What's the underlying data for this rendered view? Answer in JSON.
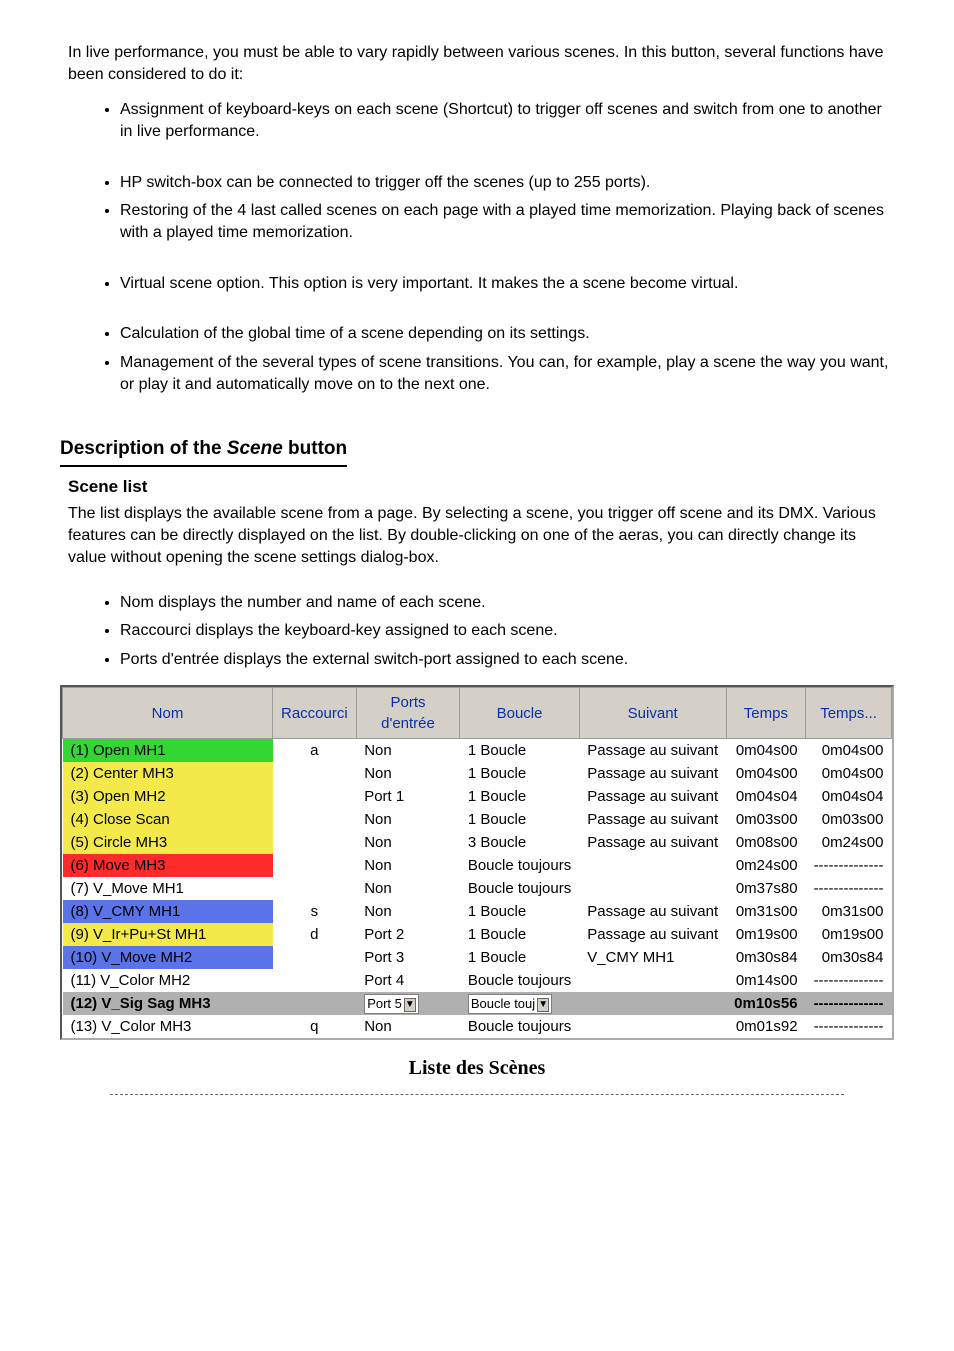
{
  "text": {
    "p1": "In live performance, you must be able to vary rapidly between various scenes. In this button, several functions have been considered to do it:",
    "bullets1": [
      "Assignment of keyboard-keys on each scene (Shortcut) to trigger off scenes and switch from one to another in live performance.",
      "HP switch-box can be connected to trigger off the scenes (up to 255 ports).",
      "Restoring of the 4 last called scenes on each page with a played time memorization. Playing back of scenes with a played time memorization."
    ],
    "bullets2": [
      "Virtual scene option. This option is very important. It makes the a scene become virtual.",
      "Calculation of the global time of a scene depending on its settings.",
      "Management of the several types of scene transitions. You can, for example, play a scene the way you want, or play it and automatically move on to the next one."
    ],
    "sectionTitlePrefix": "Description of the ",
    "sectionTitleItalic": "Scene",
    "sectionTitleSuffix": " button",
    "subtitle": "Scene list",
    "intro": "The list displays the available scene from a page. By selecting a scene, you trigger off scene and its DMX. Various features can be directly displayed on the list. By double-clicking on one of the aeras, you can directly change its value without opening the scene settings dialog-box.",
    "bullets3": [
      "Nom displays the number and name of each scene.",
      "Raccourci displays the keyboard-key assigned to each scene.",
      "Ports d'entrée displays the external switch-port assigned to each scene."
    ],
    "caption": "Liste des Scènes"
  },
  "table": {
    "headers": [
      "Nom",
      "Raccourci",
      "Ports d'entrée",
      "Boucle",
      "Suivant",
      "Temps",
      "Temps..."
    ],
    "rows": [
      {
        "color": "#33d633",
        "name": "(1) Open MH1",
        "sc": "a",
        "port": "Non",
        "boucle": "1 Boucle",
        "suivant": "Passage au suivant",
        "t1": "0m04s00",
        "t2": "0m04s00"
      },
      {
        "color": "#f3e94a",
        "name": "(2) Center MH3",
        "sc": "",
        "port": "Non",
        "boucle": "1 Boucle",
        "suivant": "Passage au suivant",
        "t1": "0m04s00",
        "t2": "0m04s00"
      },
      {
        "color": "#f3e94a",
        "name": "(3) Open MH2",
        "sc": "",
        "port": "Port 1",
        "boucle": "1 Boucle",
        "suivant": "Passage au suivant",
        "t1": "0m04s04",
        "t2": "0m04s04"
      },
      {
        "color": "#f3e94a",
        "name": "(4) Close Scan",
        "sc": "",
        "port": "Non",
        "boucle": "1 Boucle",
        "suivant": "Passage au suivant",
        "t1": "0m03s00",
        "t2": "0m03s00"
      },
      {
        "color": "#f3e94a",
        "name": "(5) Circle MH3",
        "sc": "",
        "port": "Non",
        "boucle": "3 Boucle",
        "suivant": "Passage au suivant",
        "t1": "0m08s00",
        "t2": "0m24s00"
      },
      {
        "color": "#ff2a2a",
        "name": "(6) Move MH3",
        "sc": "",
        "port": "Non",
        "boucle": "Boucle toujours",
        "suivant": "",
        "t1": "0m24s00",
        "t2": "--------------"
      },
      {
        "color": "#ffffff",
        "name": "(7) V_Move MH1",
        "sc": "",
        "port": "Non",
        "boucle": "Boucle toujours",
        "suivant": "",
        "t1": "0m37s80",
        "t2": "--------------"
      },
      {
        "color": "#5a73e8",
        "name": "(8) V_CMY MH1",
        "sc": "s",
        "port": "Non",
        "boucle": "1 Boucle",
        "suivant": "Passage au suivant",
        "t1": "0m31s00",
        "t2": "0m31s00"
      },
      {
        "color": "#f3e94a",
        "name": "(9) V_Ir+Pu+St MH1",
        "sc": "d",
        "port": "Port 2",
        "boucle": "1 Boucle",
        "suivant": "Passage au suivant",
        "t1": "0m19s00",
        "t2": "0m19s00"
      },
      {
        "color": "#5a73e8",
        "name": "(10) V_Move MH2",
        "sc": "",
        "port": "Port 3",
        "boucle": "1 Boucle",
        "suivant": "V_CMY MH1",
        "t1": "0m30s84",
        "t2": "0m30s84"
      },
      {
        "color": "#ffffff",
        "name": "(11) V_Color MH2",
        "sc": "",
        "port": "Port 4",
        "boucle": "Boucle toujours",
        "suivant": "",
        "t1": "0m14s00",
        "t2": "--------------"
      },
      {
        "color": "sel",
        "name": "(12) V_Sig Sag MH3",
        "sc": "",
        "port": "Port 5",
        "boucle": "Boucle touj",
        "suivant": "",
        "t1": "0m10s56",
        "t2": "--------------"
      },
      {
        "color": "#ffffff",
        "name": "(13) V_Color MH3",
        "sc": "q",
        "port": "Non",
        "boucle": "Boucle toujours",
        "suivant": "",
        "t1": "0m01s92",
        "t2": "--------------"
      }
    ]
  }
}
